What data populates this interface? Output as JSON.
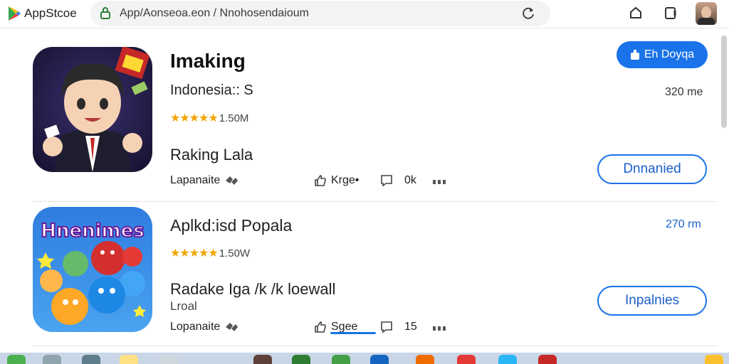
{
  "browser": {
    "brand": "AppStcoe",
    "url": "App/Aonseoa.eon / Nnohosendaioum"
  },
  "apps": [
    {
      "title": "Imaking",
      "subtitle": "Indonesia:: S",
      "rating_text": "1.50M",
      "stars": "★★★★★",
      "developer": "Raking Lala",
      "size": "320 me",
      "category": "Lapanaite",
      "meta_label": "Krge•",
      "meta_count": "0k",
      "action_button": "Dnnanied"
    },
    {
      "title": "Aplkd:isd Popala",
      "subtitle": "",
      "rating_text": "1.50W",
      "stars": "★★★★★",
      "developer": "Radake Iga /k /k loewall",
      "developer_sub": "Lroal",
      "size": "270 rm",
      "category": "Lopanaite",
      "meta_label": "Sgee",
      "meta_count": "15",
      "action_button": "Inpalnies"
    }
  ],
  "install_button": "Eh Doyqa",
  "icon_banner_text": "Hnenimes",
  "colors": {
    "accent": "#1a73e8",
    "star": "#f0a500"
  }
}
